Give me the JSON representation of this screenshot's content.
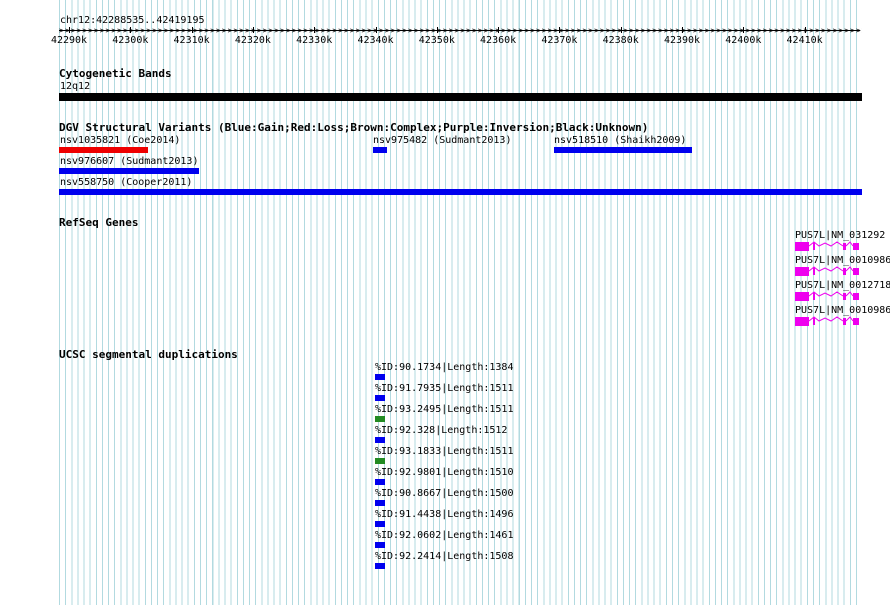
{
  "location": "chr12:42288535..42419195",
  "ruler": [
    "42290k",
    "42300k",
    "42310k",
    "42320k",
    "42330k",
    "42340k",
    "42350k",
    "42360k",
    "42370k",
    "42380k",
    "42390k",
    "42400k",
    "42410k"
  ],
  "tracks": {
    "cytoband": {
      "title": "Cytogenetic Bands",
      "band": "12q12",
      "color": "#000000"
    },
    "dgv": {
      "title": "DGV Structural Variants (Blue:Gain;Red:Loss;Brown:Complex;Purple:Inversion;Black:Unknown)",
      "features": [
        {
          "label": "nsv1035821 (Coe2014)",
          "color": "#ee0000"
        },
        {
          "label": "nsv975482 (Sudmant2013)",
          "color": "#0000ee"
        },
        {
          "label": "nsv518510 (Shaikh2009)",
          "color": "#0000ee"
        },
        {
          "label": "nsv976607 (Sudmant2013)",
          "color": "#0000ee"
        },
        {
          "label": "nsv558750 (Cooper2011)",
          "color": "#0000ee"
        }
      ]
    },
    "refseq": {
      "title": "RefSeq Genes",
      "color": "#ee00ee",
      "genes": [
        "PUS7L|NM_031292",
        "PUS7L|NM_0010986",
        "PUS7L|NM_0012718",
        "PUS7L|NM_0010986"
      ]
    },
    "segdups": {
      "title": "UCSC segmental duplications",
      "items": [
        {
          "label": "%ID:90.1734|Length:1384",
          "color": "#0000ee"
        },
        {
          "label": "%ID:91.7935|Length:1511",
          "color": "#0000ee"
        },
        {
          "label": "%ID:93.2495|Length:1511",
          "color": "#228b22"
        },
        {
          "label": "%ID:92.328|Length:1512",
          "color": "#0000ee"
        },
        {
          "label": "%ID:93.1833|Length:1511",
          "color": "#228b22"
        },
        {
          "label": "%ID:92.9801|Length:1510",
          "color": "#0000ee"
        },
        {
          "label": "%ID:90.8667|Length:1500",
          "color": "#0000ee"
        },
        {
          "label": "%ID:91.4438|Length:1496",
          "color": "#0000ee"
        },
        {
          "label": "%ID:92.0602|Length:1461",
          "color": "#0000ee"
        },
        {
          "label": "%ID:92.2414|Length:1508",
          "color": "#0000ee"
        }
      ]
    }
  }
}
